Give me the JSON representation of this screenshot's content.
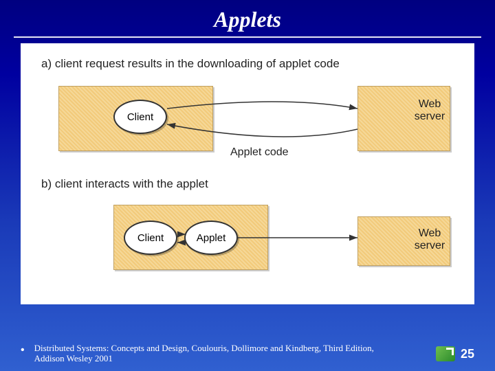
{
  "title": "Applets",
  "captions": {
    "a": "a) client request results in the downloading of applet code",
    "b": "b) client  interacts with the applet"
  },
  "nodes": {
    "client": "Client",
    "applet": "Applet",
    "webserver_line1": "Web",
    "webserver_line2": "server",
    "applet_code": "Applet code"
  },
  "footer": {
    "citation": "Distributed Systems: Concepts and Design, Coulouris, Dollimore and Kindberg, Third Edition, Addison Wesley 2001",
    "page": "25"
  }
}
